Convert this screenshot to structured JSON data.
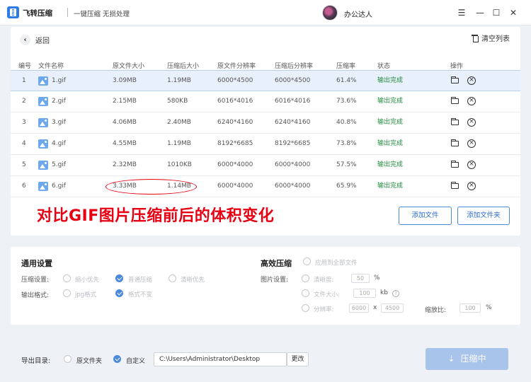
{
  "app": {
    "name": "飞转压缩",
    "subtitle": "一键压缩 无损处理",
    "user": "办公达人",
    "window_controls": [
      "menu-icon",
      "minimize-icon",
      "maximize-icon",
      "close-icon"
    ]
  },
  "toolbar": {
    "back_label": "返回",
    "clear_label": "清空列表"
  },
  "table": {
    "headers": [
      "编号",
      "文件名称",
      "原文件大小",
      "压缩后大小",
      "原文件分辨率",
      "压缩后分辨率",
      "压缩率",
      "状态",
      "操作"
    ],
    "rows": [
      {
        "index": "1",
        "name": "1.gif",
        "orig_size": "3.09MB",
        "comp_size": "1.19MB",
        "orig_res": "6000*4500",
        "comp_res": "6000*4500",
        "ratio": "61.4%",
        "status": "输出完成"
      },
      {
        "index": "2",
        "name": "2.gif",
        "orig_size": "2.15MB",
        "comp_size": "580KB",
        "orig_res": "6016*4016",
        "comp_res": "6016*4016",
        "ratio": "73.6%",
        "status": "输出完成"
      },
      {
        "index": "3",
        "name": "3.gif",
        "orig_size": "4.06MB",
        "comp_size": "2.40MB",
        "orig_res": "6240*4160",
        "comp_res": "6240*4160",
        "ratio": "40.8%",
        "status": "输出完成"
      },
      {
        "index": "4",
        "name": "4.gif",
        "orig_size": "4.55MB",
        "comp_size": "1.19MB",
        "orig_res": "8192*6685",
        "comp_res": "8192*6685",
        "ratio": "73.8%",
        "status": "输出完成"
      },
      {
        "index": "5",
        "name": "5.gif",
        "orig_size": "2.32MB",
        "comp_size": "1010KB",
        "orig_res": "6000*4000",
        "comp_res": "6000*4000",
        "ratio": "57.5%",
        "status": "输出完成"
      },
      {
        "index": "6",
        "name": "6.gif",
        "orig_size": "3.33MB",
        "comp_size": "1.14MB",
        "orig_res": "6000*4000",
        "comp_res": "6000*4000",
        "ratio": "65.9%",
        "status": "输出完成"
      }
    ]
  },
  "annotation": "对比GIF图片压缩前后的体积变化",
  "actions": {
    "add_file": "添加文件",
    "add_folder": "添加文件夹"
  },
  "settings": {
    "general_title": "通用设置",
    "compress_label": "压缩设置:",
    "compress_options": [
      "缩小优先",
      "普通压缩",
      "清晰优先"
    ],
    "output_format_label": "输出格式:",
    "format_options": [
      "jpg格式",
      "格式不变"
    ],
    "advanced_title": "高效压缩",
    "apply_all": "应用到全部文件",
    "image_settings_label": "图片设置:",
    "clarity_label": "清晰度:",
    "clarity_value": "50",
    "clarity_unit": "%",
    "filesize_label": "文件大小:",
    "filesize_value": "100",
    "filesize_unit": "kb",
    "resolution_label": "分辨率:",
    "res_width": "6000",
    "res_x": "x",
    "res_height": "4500",
    "scale_label": "缩放比:",
    "scale_value": "100",
    "scale_unit": "%"
  },
  "output": {
    "dir_label": "导出目录:",
    "option_source": "原文件夹",
    "option_custom": "自定义",
    "path": "C:\\Users\\Administrator\\Desktop",
    "change_label": "更改",
    "compress_button": "压缩中"
  },
  "colors": {
    "accent": "#4a89dc",
    "annotation_red": "#e60012",
    "status_green": "#1f8a3b",
    "selected_row": "#e8f0fb"
  }
}
